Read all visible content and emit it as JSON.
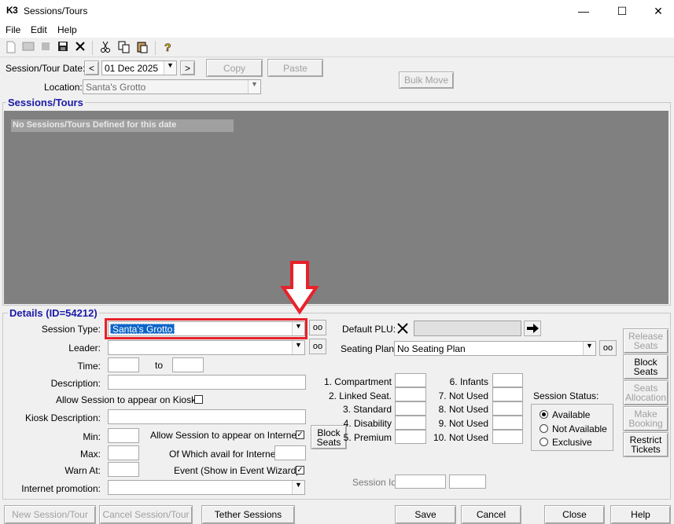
{
  "window": {
    "icon_text": "K3",
    "title": "Sessions/Tours",
    "minimize": "—",
    "maximize": "☐",
    "close": "✕"
  },
  "menu": [
    "File",
    "Edit",
    "Help"
  ],
  "session_date_label": "Session/Tour Date:",
  "prev_btn": "<",
  "next_btn": ">",
  "date_value": "01 Dec 2025",
  "copy_btn": "Copy",
  "paste_btn": "Paste",
  "location_label": "Location:",
  "location_value": "Santa's Grotto",
  "bulk_move_btn": "Bulk Move",
  "sessions_group_title": "Sessions/Tours",
  "sessions_empty": "No Sessions/Tours Defined for this date",
  "details_group_title": "Details (ID=54212)",
  "session_type_label": "Session Type:",
  "session_type_value": "Santa's Grotto",
  "leader_label": "Leader:",
  "time_label": "Time:",
  "time_to": "to",
  "description_label": "Description:",
  "kiosk_allow_label": "Allow Session to appear on Kiosk",
  "kiosk_desc_label": "Kiosk Description:",
  "min_label": "Min:",
  "max_label": "Max:",
  "warn_label": "Warn At:",
  "internet_allow_label": "Allow Session to appear on Internet",
  "internet_avail_label": "Of Which avail for Internet:",
  "event_label": "Event (Show in Event Wizard)",
  "internet_promo_label": "Internet promotion:",
  "block_seats_small": [
    "Block",
    "Seats"
  ],
  "default_plu_label": "Default PLU:",
  "seating_plan_label": "Seating Plan:",
  "seating_plan_value": "No Seating Plan",
  "seat_types_left": [
    "1. Compartment",
    "2. Linked Seat.",
    "3. Standard",
    "4. Disability",
    "5. Premium"
  ],
  "seat_types_right": [
    "6. Infants",
    "7.   Not Used",
    "8.   Not Used",
    "9.   Not Used",
    "10. Not Used"
  ],
  "session_status_label": "Session Status:",
  "status_options": [
    "Available",
    "Not Available",
    "Exclusive"
  ],
  "session_id_label": "Session Id",
  "side_buttons": [
    [
      "Release",
      "Seats"
    ],
    [
      "Block",
      "Seats"
    ],
    [
      "Seats",
      "Allocation"
    ],
    [
      "Make",
      "Booking"
    ],
    [
      "Restrict",
      "Tickets"
    ]
  ],
  "bottom_buttons": [
    "New Session/Tour",
    "Cancel Session/Tour",
    "Tether Sessions",
    "Save",
    "Cancel",
    "Close",
    "Help"
  ],
  "colors": {
    "accent_red": "#e8212a",
    "group_title": "#1a1aa8",
    "list_bg": "#808080",
    "selection": "#0a64c8"
  }
}
